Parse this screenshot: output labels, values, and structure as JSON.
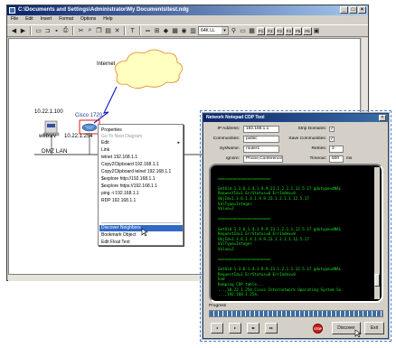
{
  "main_window": {
    "title": "C:\\Documents and Settings\\Administrator\\My Documents\\test.ndg",
    "menu": [
      "File",
      "Edit",
      "Insert",
      "Format",
      "Options",
      "Help"
    ],
    "zoom": "64K LL",
    "function_keys": [
      "F1",
      "F2",
      "F3",
      "F4",
      "F5",
      "F6"
    ],
    "minimize": "_",
    "maximize": "□",
    "close": "×"
  },
  "diagram": {
    "cloud_label": "Internet",
    "nodes": [
      {
        "ip": "10.22.1.100",
        "name": "websrv"
      },
      {
        "ip": "Cisco 1720",
        "name": "10.22.1.254"
      }
    ],
    "lan_label": "DMZ LAN"
  },
  "context_menu": {
    "items": [
      {
        "label": "Properties",
        "disabled": false
      },
      {
        "label": "Go To Next Diagram",
        "disabled": true
      },
      {
        "label": "Edit",
        "disabled": false
      },
      {
        "label": "Link",
        "disabled": false
      },
      {
        "label": "telnet 192.168.1.1",
        "disabled": false
      },
      {
        "label": "Copy2Clipboard 192.168.1.1",
        "disabled": false
      },
      {
        "label": "Copy2Clipboard telnet 192.168.1.1",
        "disabled": false
      },
      {
        "label": "$explore http://192.168.1.1",
        "disabled": false
      },
      {
        "label": "$explore https://192.168.1.1",
        "disabled": false
      },
      {
        "label": "ping -t 192.168.1.1",
        "disabled": false
      },
      {
        "label": "RDP 192.168.1.1",
        "disabled": false
      },
      {
        "label": "Discover Neighbors",
        "disabled": false,
        "highlighted": true
      },
      {
        "label": "Bookmark Object",
        "disabled": false
      },
      {
        "label": "Edit Float Text",
        "disabled": false
      }
    ],
    "submenu_arrow": "▸"
  },
  "cdp_tool": {
    "title": "Network Notepad CDP Tool",
    "close": "×",
    "fields": {
      "ip_address": {
        "label": "IP Address:",
        "value": "192.168.1.1"
      },
      "communities": {
        "label": "Communities:",
        "value": "public"
      },
      "sysname": {
        "label": "SysName:",
        "value": "router1"
      },
      "ignore": {
        "label": "Ignore:",
        "value": "Phone,Conference"
      },
      "strip_domains": {
        "label": "Strip Domains:",
        "checked": true
      },
      "save_communities": {
        "label": "Save Communities:",
        "checked": true
      },
      "retries": {
        "label": "Retries:",
        "value": "3"
      },
      "timeout": {
        "label": "Timeout:",
        "value": "500",
        "unit": "ms"
      }
    },
    "terminal_lines": [
      "",
      "=======================",
      "",
      "GetOid 1.3.6.1.4.1.9.9.23.1.2.1.1.12.5.17 gdutype=dNAL",
      "RequestId=1 ErrStatus=0 ErrIndex=0",
      " ObjId=1.3.6.1.4.1.9.9.23.1.2.1.1.12.5.17",
      "ValType=Integer",
      "Value=2",
      "",
      "=======================",
      "",
      "GetOid 1.3.6.1.4.1.9.9.23.1.2.1.1.12.5.17 gdutype=dNAL",
      "RequestId=1 ErrStatus=0 ErrIndex=0",
      " ObjId=1.3.6.1.4.1.9.9.23.1.2.1.1.12.5.17",
      "ValType=Integer",
      "Value=2",
      "",
      "=======================",
      "",
      "GetOid 1.3.6.1.4.1.9.9.23.1.2.1.1.12.5.17 gdutype=dNAL",
      "RequestId=1 ErrStatus=0 ErrIndex=0",
      "End",
      "Dumping CDP table...",
      "...,10.22.1.254,Cisco Internetwork Operating System So",
      "...,192.168.1.254,"
    ],
    "progress_label": "Progress",
    "progress": 1.0,
    "nav_buttons": [
      "◂",
      "▸",
      "◂▸",
      "▸▸"
    ],
    "stop_label": "STOP",
    "discover_label": "Discover",
    "exit_label": "Exit"
  },
  "colors": {
    "titlebar": "#0a246a",
    "terminal_text": "#19e619",
    "highlight": "#316ac5",
    "cloud": "#ffffc0",
    "lightning": "#2020c0"
  }
}
